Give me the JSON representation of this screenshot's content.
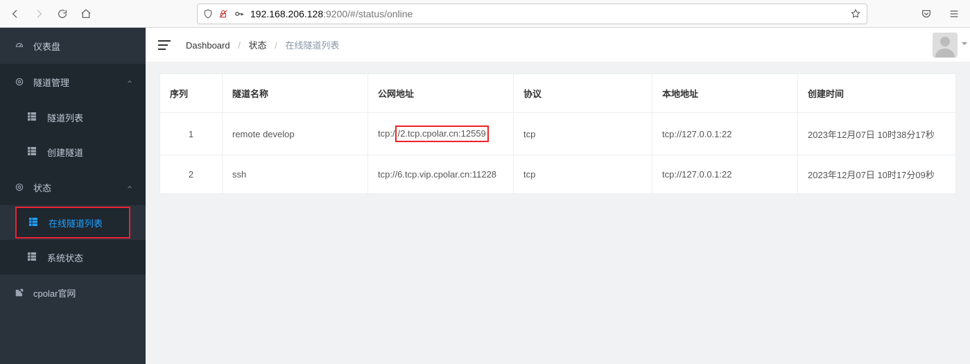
{
  "browser": {
    "url_dim_prefix": "192.168.206.128",
    "url_port": ":9200",
    "url_path": "/#/status/online"
  },
  "sidebar": {
    "dashboard": "仪表盘",
    "tunnel_mgmt": "隧道管理",
    "tunnel_list": "隧道列表",
    "tunnel_create": "创建隧道",
    "status": "状态",
    "online_list": "在线隧道列表",
    "system_status": "系统状态",
    "cpolar_site": "cpolar官网"
  },
  "breadcrumb": {
    "root": "Dashboard",
    "parent": "状态",
    "current": "在线隧道列表"
  },
  "table": {
    "headers": {
      "seq": "序列",
      "name": "隧道名称",
      "public": "公网地址",
      "proto": "协议",
      "local": "本地地址",
      "created": "创建时间"
    },
    "rows": [
      {
        "seq": "1",
        "name": "remote develop",
        "public_pre": "tcp:/",
        "public_hl": "/2.tcp.cpolar.cn:12559",
        "public_post": "",
        "proto": "tcp",
        "local": "tcp://127.0.0.1:22",
        "created": "2023年12月07日 10时38分17秒"
      },
      {
        "seq": "2",
        "name": "ssh",
        "public_pre": "tcp://6.tcp.vip.cpolar.cn:11228",
        "public_hl": "",
        "public_post": "",
        "proto": "tcp",
        "local": "tcp://127.0.0.1:22",
        "created": "2023年12月07日 10时17分09秒"
      }
    ]
  }
}
